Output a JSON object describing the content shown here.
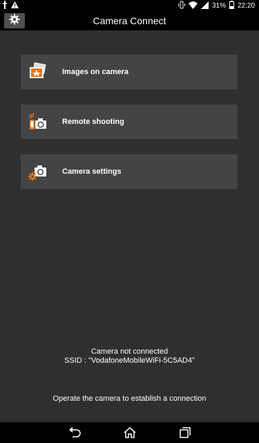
{
  "status_bar": {
    "battery": "31%",
    "time": "22:20"
  },
  "app": {
    "title": "Camera Connect"
  },
  "menu": [
    {
      "label": "Images on camera",
      "icon": "images-icon"
    },
    {
      "label": "Remote shooting",
      "icon": "remote-shooting-icon"
    },
    {
      "label": "Camera settings",
      "icon": "camera-settings-icon"
    }
  ],
  "connection": {
    "status": "Camera not connected",
    "ssid": "SSID : \"VodafoneMobileWiFi-5C5AD4\"",
    "hint": "Operate the camera to establish a connection"
  },
  "colors": {
    "accent": "#e8731c",
    "background": "#2f2f2f",
    "menu_item": "#444444"
  }
}
